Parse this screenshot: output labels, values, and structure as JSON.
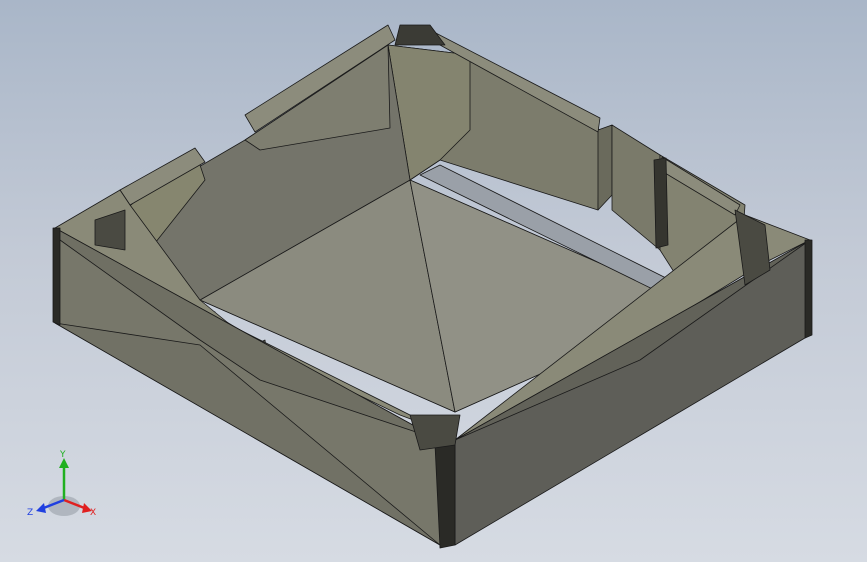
{
  "viewport": {
    "background_top": "#a9b6c8",
    "background_bottom": "#d6dbe3"
  },
  "model": {
    "shaded_color": "#7f806f",
    "edge_color": "#1a1a1a"
  },
  "triad": {
    "x_label": "X",
    "y_label": "Y",
    "z_label": "Z",
    "x_color": "#e02020",
    "y_color": "#20b020",
    "z_color": "#2040e0"
  }
}
